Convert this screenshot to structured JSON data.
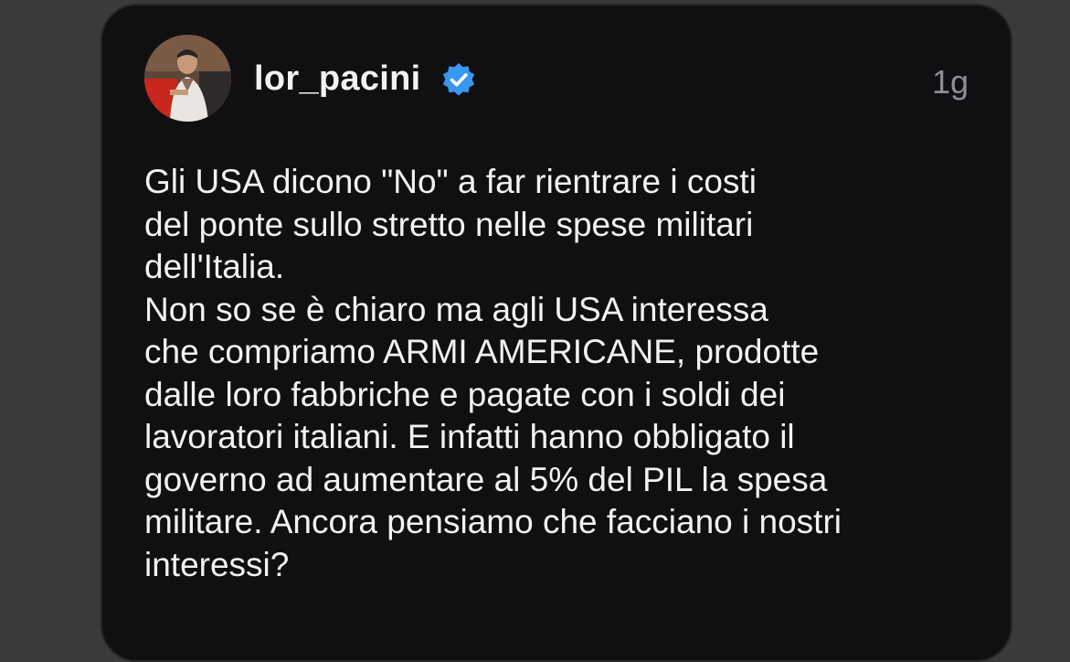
{
  "post": {
    "author": {
      "username": "lor_pacini",
      "verified": true,
      "avatar_icon": "profile-photo",
      "verified_icon": "verified-badge-icon",
      "verified_color": "#3897f0"
    },
    "timestamp": "1g",
    "text": "Gli USA dicono \"No\" a far rientrare i costi\ndel ponte sullo stretto nelle spese militari\ndell'Italia.\nNon so se è chiaro ma agli USA interessa\nche compriamo ARMI AMERICANE, prodotte\ndalle loro fabbriche e pagate con i soldi dei\nlavoratori italiani. E infatti hanno obbligato il\ngoverno ad aumentare al 5% del PIL la spesa\nmilitare. Ancora pensiamo che facciano i nostri\ninteressi?"
  },
  "colors": {
    "background": "#3a3a3c",
    "card": "#101012",
    "text": "#f2f2f2",
    "muted": "#8e8e93"
  }
}
